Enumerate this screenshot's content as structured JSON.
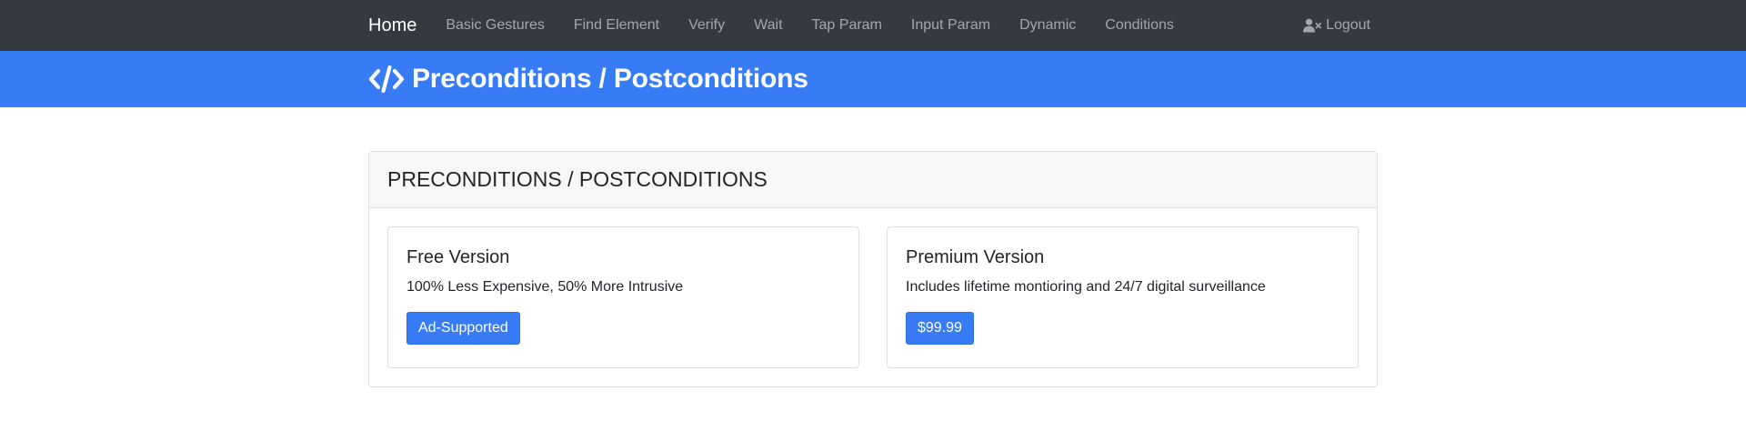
{
  "navbar": {
    "brand": "Home",
    "items": [
      {
        "label": "Basic Gestures"
      },
      {
        "label": "Find Element"
      },
      {
        "label": "Verify"
      },
      {
        "label": "Wait"
      },
      {
        "label": "Tap Param"
      },
      {
        "label": "Input Param"
      },
      {
        "label": "Dynamic"
      },
      {
        "label": "Conditions"
      }
    ],
    "logout_label": "Logout",
    "logout_icon": "user-times-icon"
  },
  "banner": {
    "icon": "code-icon",
    "title": "Preconditions / Postconditions"
  },
  "card": {
    "header": "PRECONDITIONS / POSTCONDITIONS",
    "free": {
      "title": "Free Version",
      "text": "100% Less Expensive, 50% More Intrusive",
      "button": "Ad-Supported"
    },
    "premium": {
      "title": "Premium Version",
      "text": "Includes lifetime montioring and 24/7 digital surveillance",
      "button": "$99.99"
    }
  },
  "colors": {
    "navbar_bg": "#343a40",
    "primary": "#377cf6"
  }
}
